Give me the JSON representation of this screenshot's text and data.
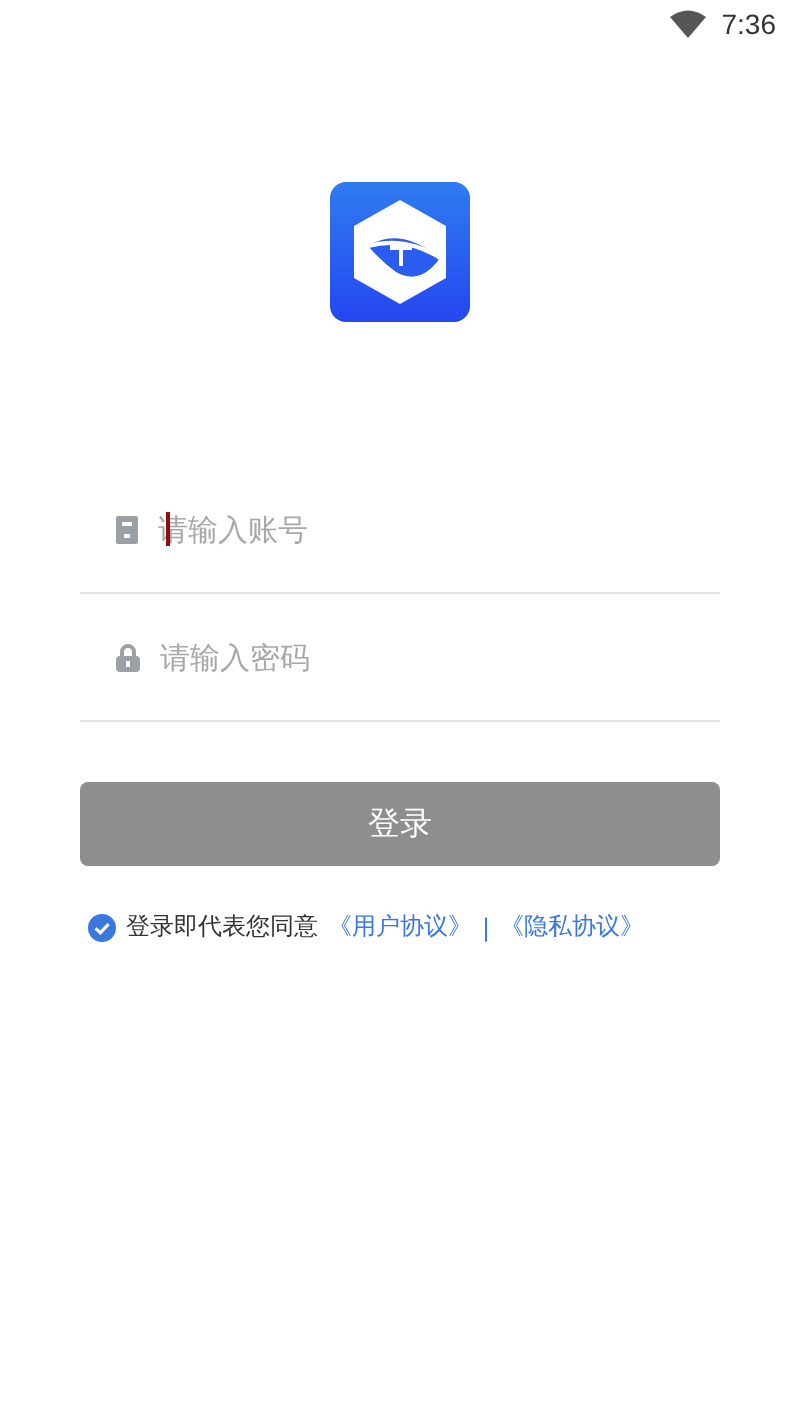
{
  "status_bar": {
    "time": "7:36"
  },
  "login_form": {
    "fields": [
      {
        "kind": "account",
        "placeholder": "请输入账号",
        "focused": true
      },
      {
        "kind": "password",
        "placeholder": "请输入密码",
        "focused": false
      }
    ],
    "login_button": {
      "label": "登录",
      "disabled": true
    }
  },
  "agreement": {
    "checked": true,
    "text": "登录即代表您同意",
    "links": [
      "《用户协议》",
      "《隐私协议》"
    ],
    "separator": "|"
  }
}
